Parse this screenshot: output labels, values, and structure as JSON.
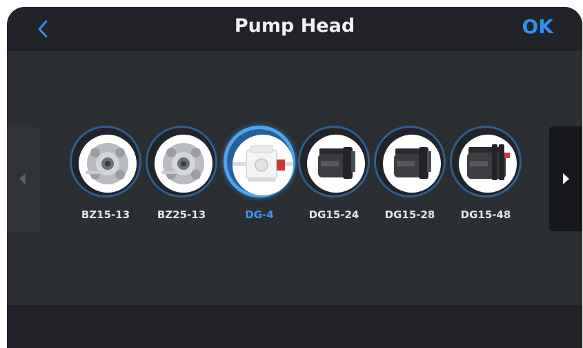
{
  "header": {
    "title": "Pump Head",
    "ok_label": "OK",
    "back_icon": "chevron-left-icon"
  },
  "carousel": {
    "left_icon": "triangle-left-icon",
    "right_icon": "triangle-right-icon",
    "items": [
      {
        "label": "BZ15-13",
        "image": "pump-head-bz-icon",
        "selected": false
      },
      {
        "label": "BZ25-13",
        "image": "pump-head-bz-icon",
        "selected": false
      },
      {
        "label": "DG-4",
        "image": "pump-head-dg4-icon",
        "selected": true
      },
      {
        "label": "DG15-24",
        "image": "pump-head-dg-icon",
        "selected": false
      },
      {
        "label": "DG15-28",
        "image": "pump-head-dg-icon",
        "selected": false
      },
      {
        "label": "DG15-48",
        "image": "pump-head-dg-icon",
        "selected": false
      }
    ]
  },
  "colors": {
    "accent": "#2e8ff0",
    "screen_bg": "#2b2e33",
    "header_bg": "#212328"
  }
}
